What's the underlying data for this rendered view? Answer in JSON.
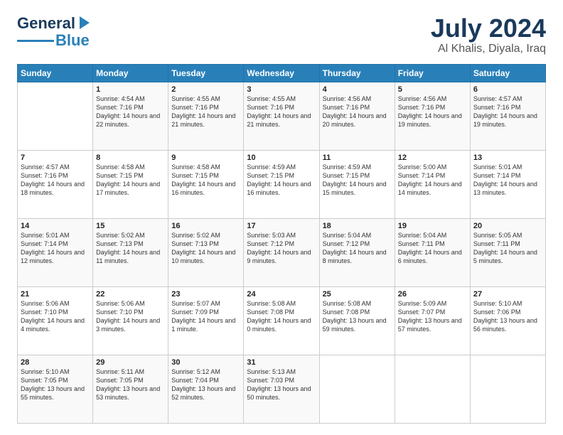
{
  "logo": {
    "line1": "General",
    "line2": "Blue"
  },
  "title": "July 2024",
  "subtitle": "Al Khalis, Diyala, Iraq",
  "days": [
    "Sunday",
    "Monday",
    "Tuesday",
    "Wednesday",
    "Thursday",
    "Friday",
    "Saturday"
  ],
  "weeks": [
    [
      {
        "num": "",
        "sunrise": "",
        "sunset": "",
        "daylight": ""
      },
      {
        "num": "1",
        "sunrise": "Sunrise: 4:54 AM",
        "sunset": "Sunset: 7:16 PM",
        "daylight": "Daylight: 14 hours and 22 minutes."
      },
      {
        "num": "2",
        "sunrise": "Sunrise: 4:55 AM",
        "sunset": "Sunset: 7:16 PM",
        "daylight": "Daylight: 14 hours and 21 minutes."
      },
      {
        "num": "3",
        "sunrise": "Sunrise: 4:55 AM",
        "sunset": "Sunset: 7:16 PM",
        "daylight": "Daylight: 14 hours and 21 minutes."
      },
      {
        "num": "4",
        "sunrise": "Sunrise: 4:56 AM",
        "sunset": "Sunset: 7:16 PM",
        "daylight": "Daylight: 14 hours and 20 minutes."
      },
      {
        "num": "5",
        "sunrise": "Sunrise: 4:56 AM",
        "sunset": "Sunset: 7:16 PM",
        "daylight": "Daylight: 14 hours and 19 minutes."
      },
      {
        "num": "6",
        "sunrise": "Sunrise: 4:57 AM",
        "sunset": "Sunset: 7:16 PM",
        "daylight": "Daylight: 14 hours and 19 minutes."
      }
    ],
    [
      {
        "num": "7",
        "sunrise": "Sunrise: 4:57 AM",
        "sunset": "Sunset: 7:16 PM",
        "daylight": "Daylight: 14 hours and 18 minutes."
      },
      {
        "num": "8",
        "sunrise": "Sunrise: 4:58 AM",
        "sunset": "Sunset: 7:15 PM",
        "daylight": "Daylight: 14 hours and 17 minutes."
      },
      {
        "num": "9",
        "sunrise": "Sunrise: 4:58 AM",
        "sunset": "Sunset: 7:15 PM",
        "daylight": "Daylight: 14 hours and 16 minutes."
      },
      {
        "num": "10",
        "sunrise": "Sunrise: 4:59 AM",
        "sunset": "Sunset: 7:15 PM",
        "daylight": "Daylight: 14 hours and 16 minutes."
      },
      {
        "num": "11",
        "sunrise": "Sunrise: 4:59 AM",
        "sunset": "Sunset: 7:15 PM",
        "daylight": "Daylight: 14 hours and 15 minutes."
      },
      {
        "num": "12",
        "sunrise": "Sunrise: 5:00 AM",
        "sunset": "Sunset: 7:14 PM",
        "daylight": "Daylight: 14 hours and 14 minutes."
      },
      {
        "num": "13",
        "sunrise": "Sunrise: 5:01 AM",
        "sunset": "Sunset: 7:14 PM",
        "daylight": "Daylight: 14 hours and 13 minutes."
      }
    ],
    [
      {
        "num": "14",
        "sunrise": "Sunrise: 5:01 AM",
        "sunset": "Sunset: 7:14 PM",
        "daylight": "Daylight: 14 hours and 12 minutes."
      },
      {
        "num": "15",
        "sunrise": "Sunrise: 5:02 AM",
        "sunset": "Sunset: 7:13 PM",
        "daylight": "Daylight: 14 hours and 11 minutes."
      },
      {
        "num": "16",
        "sunrise": "Sunrise: 5:02 AM",
        "sunset": "Sunset: 7:13 PM",
        "daylight": "Daylight: 14 hours and 10 minutes."
      },
      {
        "num": "17",
        "sunrise": "Sunrise: 5:03 AM",
        "sunset": "Sunset: 7:12 PM",
        "daylight": "Daylight: 14 hours and 9 minutes."
      },
      {
        "num": "18",
        "sunrise": "Sunrise: 5:04 AM",
        "sunset": "Sunset: 7:12 PM",
        "daylight": "Daylight: 14 hours and 8 minutes."
      },
      {
        "num": "19",
        "sunrise": "Sunrise: 5:04 AM",
        "sunset": "Sunset: 7:11 PM",
        "daylight": "Daylight: 14 hours and 6 minutes."
      },
      {
        "num": "20",
        "sunrise": "Sunrise: 5:05 AM",
        "sunset": "Sunset: 7:11 PM",
        "daylight": "Daylight: 14 hours and 5 minutes."
      }
    ],
    [
      {
        "num": "21",
        "sunrise": "Sunrise: 5:06 AM",
        "sunset": "Sunset: 7:10 PM",
        "daylight": "Daylight: 14 hours and 4 minutes."
      },
      {
        "num": "22",
        "sunrise": "Sunrise: 5:06 AM",
        "sunset": "Sunset: 7:10 PM",
        "daylight": "Daylight: 14 hours and 3 minutes."
      },
      {
        "num": "23",
        "sunrise": "Sunrise: 5:07 AM",
        "sunset": "Sunset: 7:09 PM",
        "daylight": "Daylight: 14 hours and 1 minute."
      },
      {
        "num": "24",
        "sunrise": "Sunrise: 5:08 AM",
        "sunset": "Sunset: 7:08 PM",
        "daylight": "Daylight: 14 hours and 0 minutes."
      },
      {
        "num": "25",
        "sunrise": "Sunrise: 5:08 AM",
        "sunset": "Sunset: 7:08 PM",
        "daylight": "Daylight: 13 hours and 59 minutes."
      },
      {
        "num": "26",
        "sunrise": "Sunrise: 5:09 AM",
        "sunset": "Sunset: 7:07 PM",
        "daylight": "Daylight: 13 hours and 57 minutes."
      },
      {
        "num": "27",
        "sunrise": "Sunrise: 5:10 AM",
        "sunset": "Sunset: 7:06 PM",
        "daylight": "Daylight: 13 hours and 56 minutes."
      }
    ],
    [
      {
        "num": "28",
        "sunrise": "Sunrise: 5:10 AM",
        "sunset": "Sunset: 7:05 PM",
        "daylight": "Daylight: 13 hours and 55 minutes."
      },
      {
        "num": "29",
        "sunrise": "Sunrise: 5:11 AM",
        "sunset": "Sunset: 7:05 PM",
        "daylight": "Daylight: 13 hours and 53 minutes."
      },
      {
        "num": "30",
        "sunrise": "Sunrise: 5:12 AM",
        "sunset": "Sunset: 7:04 PM",
        "daylight": "Daylight: 13 hours and 52 minutes."
      },
      {
        "num": "31",
        "sunrise": "Sunrise: 5:13 AM",
        "sunset": "Sunset: 7:03 PM",
        "daylight": "Daylight: 13 hours and 50 minutes."
      },
      {
        "num": "",
        "sunrise": "",
        "sunset": "",
        "daylight": ""
      },
      {
        "num": "",
        "sunrise": "",
        "sunset": "",
        "daylight": ""
      },
      {
        "num": "",
        "sunrise": "",
        "sunset": "",
        "daylight": ""
      }
    ]
  ]
}
